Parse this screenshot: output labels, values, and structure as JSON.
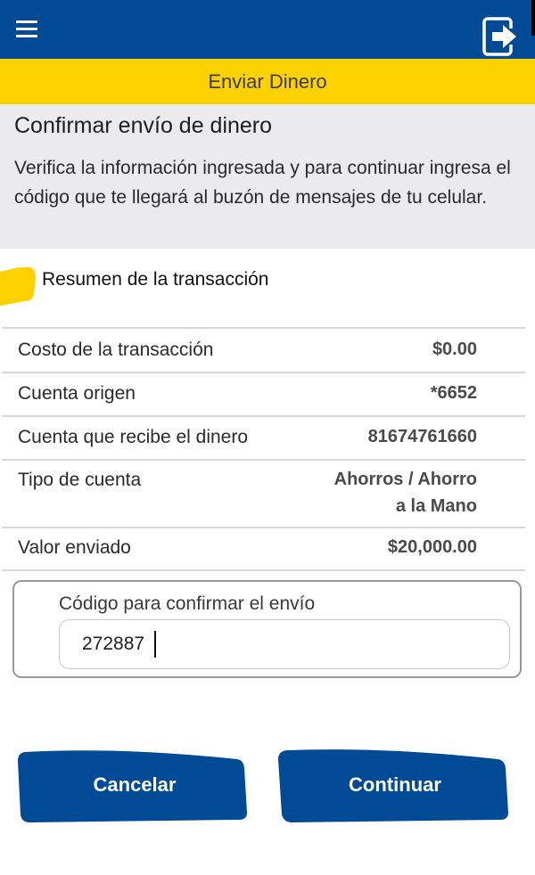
{
  "header": {
    "menu_icon": "hamburger-menu-icon",
    "logout_icon": "logout-exit-icon",
    "section_banner": "Enviar Dinero"
  },
  "intro": {
    "title": "Confirmar envío de dinero",
    "description": "Verifica la información ingresada y para continuar ingresa el código que te llegará al buzón de mensajes de tu celular."
  },
  "summary": {
    "title": "Resumen de la transacción",
    "rows": [
      {
        "label": "Costo de la transacción",
        "value": "$0.00"
      },
      {
        "label": "Cuenta origen",
        "value": "*6652"
      },
      {
        "label": "Cuenta que recibe el dinero",
        "value": "81674761660"
      },
      {
        "label": "Tipo de cuenta",
        "value_line1": "Ahorros / Ahorro",
        "value_line2": "a la Mano"
      },
      {
        "label": "Valor enviado",
        "value": "$20,000.00"
      }
    ]
  },
  "code": {
    "label": "Código para confirmar el envío",
    "value": "272887"
  },
  "actions": {
    "cancel_label": "Cancelar",
    "continue_label": "Continuar"
  },
  "colors": {
    "primary_blue": "#004a96",
    "accent_yellow": "#fdd200",
    "gray_panel": "#ebebed"
  }
}
